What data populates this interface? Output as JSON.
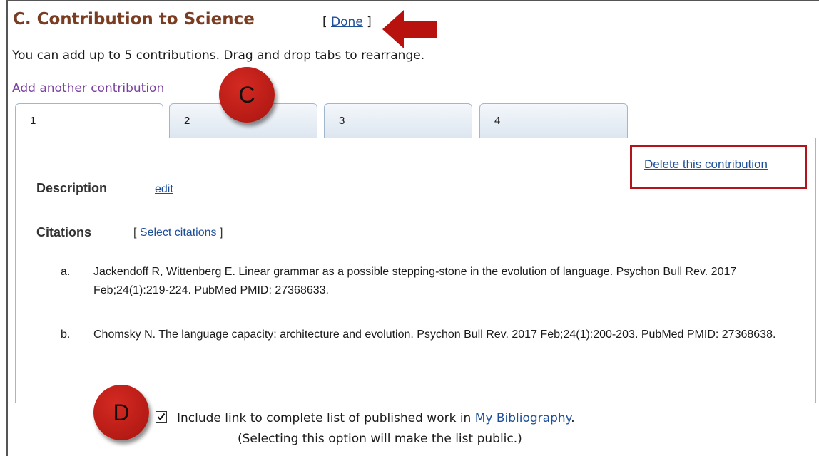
{
  "header": {
    "title": "C. Contribution to Science",
    "done_open": "[ ",
    "done_label": "Done",
    "done_close": " ]"
  },
  "intro": "You can add up to 5 contributions. Drag and drop tabs to rearrange.",
  "add_link": "Add another contribution",
  "tabs": [
    "1",
    "2",
    "3",
    "4"
  ],
  "active_tab": "1",
  "panel": {
    "delete_link": "Delete this contribution",
    "description_label": "Description",
    "description_edit": "edit",
    "citations_label": "Citations",
    "select_open": "[ ",
    "select_label": "Select citations",
    "select_close": " ]",
    "citations": [
      {
        "marker": "a.",
        "text": "Jackendoff R, Wittenberg E. Linear grammar as a possible stepping-stone in the evolution of language. Psychon Bull Rev. 2017 Feb;24(1):219-224. PubMed PMID: 27368633."
      },
      {
        "marker": "b.",
        "text": "Chomsky N. The language capacity: architecture and evolution. Psychon Bull Rev. 2017 Feb;24(1):200-203. PubMed PMID: 27368638."
      }
    ]
  },
  "checkbox": {
    "checked": true,
    "label_before": "Include link to complete list of published work in ",
    "link": "My Bibliography",
    "label_after": ".",
    "note": "(Selecting this option will make the list public.)"
  },
  "annotations": {
    "badge_c": "C",
    "badge_d": "D",
    "arrow_icon": "red-left-arrow-icon",
    "highlight_color": "#b1141a"
  }
}
